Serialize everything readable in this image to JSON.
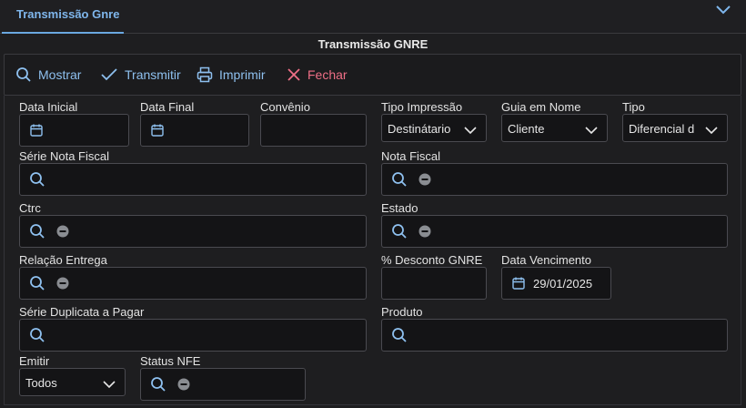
{
  "tab": {
    "label": "Transmissão Gnre"
  },
  "form": {
    "title": "Transmissão GNRE"
  },
  "toolbar": {
    "show_label": "Mostrar",
    "transmit_label": "Transmitir",
    "print_label": "Imprimir",
    "close_label": "Fechar"
  },
  "fields": {
    "data_inicial": {
      "label": "Data Inicial",
      "value": ""
    },
    "data_final": {
      "label": "Data Final",
      "value": ""
    },
    "convenio": {
      "label": "Convênio",
      "value": ""
    },
    "tipo_impressao": {
      "label": "Tipo Impressão",
      "value": "Destinátario"
    },
    "guia_em_nome": {
      "label": "Guia em Nome",
      "value": "Cliente"
    },
    "tipo": {
      "label": "Tipo",
      "value": "Diferencial d"
    },
    "serie_nota_fiscal": {
      "label": "Série Nota Fiscal"
    },
    "nota_fiscal": {
      "label": "Nota Fiscal"
    },
    "ctrc": {
      "label": "Ctrc"
    },
    "estado": {
      "label": "Estado"
    },
    "relacao_entrega": {
      "label": "Relação Entrega"
    },
    "desconto_gnre": {
      "label": "% Desconto GNRE",
      "value": ""
    },
    "data_vencimento": {
      "label": "Data Vencimento",
      "value": "29/01/2025"
    },
    "serie_duplicata": {
      "label": "Série Duplicata a Pagar"
    },
    "produto": {
      "label": "Produto"
    },
    "emitir": {
      "label": "Emitir",
      "value": "Todos"
    },
    "status_nfe": {
      "label": "Status NFE"
    }
  },
  "colors": {
    "accent_blue": "#8ec0ef",
    "close_red": "#ef6f86",
    "background": "#1e1e20",
    "input_background": "#141416"
  },
  "icons": [
    "chevron-down-icon",
    "search-icon",
    "check-icon",
    "printer-icon",
    "close-icon",
    "calendar-icon",
    "minus-circle-icon"
  ]
}
